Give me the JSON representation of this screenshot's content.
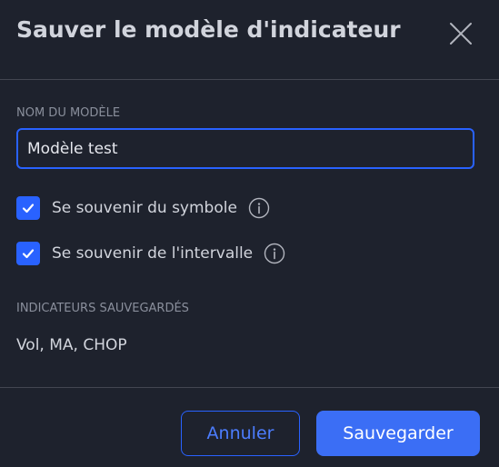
{
  "dialog": {
    "title": "Sauver le modèle d'indicateur",
    "close_icon": "close-icon"
  },
  "template_name": {
    "label": "NOM DU MODÈLE",
    "value": "Modèle test"
  },
  "options": [
    {
      "label": "Se souvenir du symbole",
      "checked": true,
      "icon": "info-icon"
    },
    {
      "label": "Se souvenir de l'intervalle",
      "checked": true,
      "icon": "info-icon"
    }
  ],
  "saved_indicators": {
    "label": "INDICATEURS SAUVEGARDÉS",
    "value": "Vol, MA, CHOP"
  },
  "footer": {
    "cancel_label": "Annuler",
    "save_label": "Sauvegarder"
  },
  "colors": {
    "background": "#1e222d",
    "accent": "#2962ff",
    "text": "#d1d4dc",
    "muted": "#8a8f9c"
  }
}
